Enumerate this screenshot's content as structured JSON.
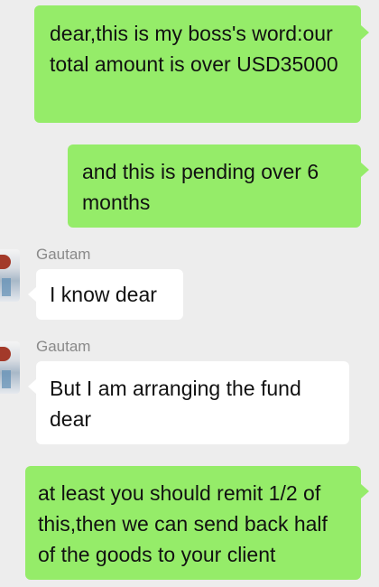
{
  "messages": [
    {
      "direction": "out",
      "text": "dear,this is my boss's word:our total amount is over USD35000"
    },
    {
      "direction": "out",
      "text": "and this is pending over 6 months"
    },
    {
      "direction": "in",
      "sender": "Gautam",
      "avatar_icon": "user-avatar",
      "text": "I know dear"
    },
    {
      "direction": "in",
      "sender": "Gautam",
      "avatar_icon": "user-avatar",
      "text": "But I am arranging the fund dear"
    },
    {
      "direction": "out",
      "text": "at least you should remit 1/2 of this,then we can send back half of the goods to your client"
    }
  ],
  "colors": {
    "background": "#ededed",
    "outgoing_bubble": "#95ec69",
    "incoming_bubble": "#ffffff",
    "sender_name": "#8a8a8a"
  }
}
